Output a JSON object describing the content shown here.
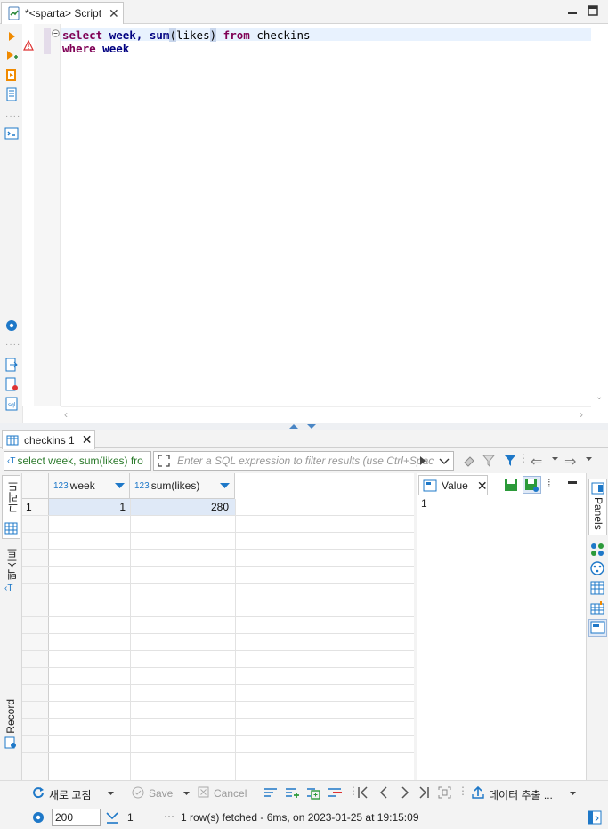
{
  "editor_tab": {
    "title": "*<sparta> Script"
  },
  "editor": {
    "line1": {
      "kw1": "select",
      "id1": "week,",
      "fn": "sum",
      "paren_open": "(",
      "arg": "likes",
      "paren_close": ")",
      "kw2": "from",
      "id2": "checkins"
    },
    "line2": {
      "kw1": "where",
      "id1": "week"
    }
  },
  "results_tab": {
    "title": "checkins 1"
  },
  "filter": {
    "query_label": "select week, sum(likes) fro",
    "placeholder": "Enter a SQL expression to filter results (use Ctrl+Space)"
  },
  "left_tabs": {
    "grid": "그리드",
    "text": "텍스트",
    "record": "Record"
  },
  "grid": {
    "columns": [
      {
        "type_badge": "123",
        "name": "week"
      },
      {
        "type_badge": "123",
        "name": "sum(likes)"
      }
    ],
    "rows": [
      {
        "num": "1",
        "week": "1",
        "sum_likes": "280"
      }
    ]
  },
  "value_panel": {
    "tab_label": "Value",
    "content": "1"
  },
  "right_panel": {
    "panels_label": "Panels"
  },
  "bottom_toolbar": {
    "refresh_label": "새로 고침",
    "save_label": "Save",
    "cancel_label": "Cancel",
    "export_label": "데이터 추출 ..."
  },
  "status": {
    "fetch_size": "200",
    "row_count": "1",
    "message": "1 row(s) fetched - 6ms, on 2023-01-25 at 19:15:09"
  },
  "colors": {
    "keyword": "#7f0055",
    "identifier": "#000080",
    "selection": "#dfe9f7",
    "accent": "#1e78c8"
  }
}
